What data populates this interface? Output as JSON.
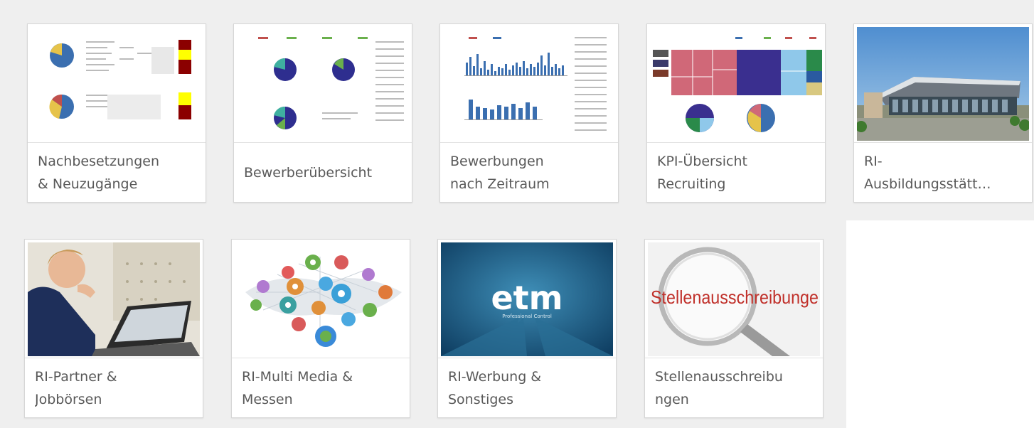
{
  "app_cards": [
    {
      "title": "Nachbesetzungen\n& Neuzugänge",
      "thumbnail": "dashboard-pies-tables"
    },
    {
      "title": "Bewerberübersicht",
      "thumbnail": "dashboard-three-pies"
    },
    {
      "title": "Bewerbungen\nnach Zeitraum",
      "thumbnail": "dashboard-bar-charts"
    },
    {
      "title": "KPI-Übersicht\nRecruiting",
      "thumbnail": "dashboard-treemap"
    },
    {
      "title": "RI-\nAusbildungsstätt…",
      "thumbnail": "photo-modern-building"
    },
    {
      "title": "RI-Partner &\nJobbörsen",
      "thumbnail": "photo-man-at-laptop"
    },
    {
      "title": "RI-Multi Media &\nMessen",
      "thumbnail": "illustration-social-media-network"
    },
    {
      "title": "RI-Werbung &\nSonstiges",
      "thumbnail": "logo-etm"
    },
    {
      "title": "Stellenausschreibu\nngen",
      "thumbnail": "illustration-magnifier-text"
    }
  ],
  "thumb_text": {
    "etm_logo": "etm",
    "etm_tagline": "Professional Control",
    "stellen_word": "Stellenausschreibunge"
  },
  "colors": {
    "page_background": "#efefef",
    "card_border": "#d6d6d6",
    "caption_text": "#595959"
  }
}
